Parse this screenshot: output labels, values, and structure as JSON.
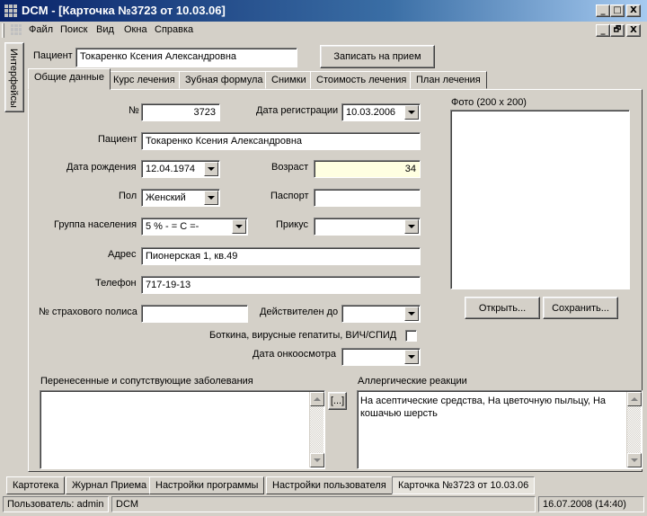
{
  "window": {
    "title": "DCM - [Карточка №3723 от 10.03.06]",
    "controls": {
      "minimize": "_",
      "maximize": "□",
      "close": "X",
      "restore": "🗗"
    }
  },
  "menu": [
    "Файл",
    "Поиск",
    "Вид",
    "Окна",
    "Справка"
  ],
  "side_tab": "Интерфейсы",
  "patient_header": {
    "label": "Пациент",
    "value": "Токаренко Ксения Александровна",
    "appointment_button": "Записать на прием"
  },
  "tabs": [
    "Общие данные",
    "Курс лечения",
    "Зубная формула",
    "Снимки",
    "Стоимость лечения",
    "План лечения"
  ],
  "form": {
    "number": {
      "label": "№",
      "value": "3723"
    },
    "registration_date": {
      "label": "Дата регистрации",
      "value": "10.03.2006"
    },
    "patient": {
      "label": "Пациент",
      "value": "Токаренко Ксения Александровна"
    },
    "birth_date": {
      "label": "Дата рождения",
      "value": "12.04.1974"
    },
    "age": {
      "label": "Возраст",
      "value": "34"
    },
    "sex": {
      "label": "Пол",
      "value": "Женский"
    },
    "passport": {
      "label": "Паспорт",
      "value": ""
    },
    "population_group": {
      "label": "Группа населения",
      "value": "5 % - = С =-"
    },
    "attachment": {
      "label": "Прикус",
      "value": ""
    },
    "address": {
      "label": "Адрес",
      "value": "Пионерская 1, кв.49"
    },
    "phone": {
      "label": "Телефон",
      "value": "717-19-13"
    },
    "insurance": {
      "label": "№ страхового полиса",
      "value": ""
    },
    "valid_until": {
      "label": "Действителен до",
      "value": " .  . "
    },
    "diseases_flag": {
      "label": "Боткина, вирусные гепатиты, ВИЧ/СПИД",
      "checked": false
    },
    "oncology_date": {
      "label": "Дата онкоосмотра",
      "value": " .  . "
    }
  },
  "photo": {
    "label": "Фото (200 x 200)",
    "open_button": "Открыть...",
    "save_button": "Сохранить..."
  },
  "diseases": {
    "label": "Перенесенные и сопутствующие заболевания",
    "value": "",
    "ellipsis_button": "[...]"
  },
  "allergies": {
    "label": "Аллергические реакции",
    "value": "На асептические средства, На цветочную пыльцу, На кошачью шерсть"
  },
  "bottom_tabs": [
    "Картотека",
    "Журнал Приема",
    "Настройки программы",
    "Настройки пользователя",
    "Карточка №3723 от 10.03.06"
  ],
  "status": {
    "user": "Пользователь: admin",
    "app": "DCM",
    "datetime": "16.07.2008 (14:40)"
  }
}
